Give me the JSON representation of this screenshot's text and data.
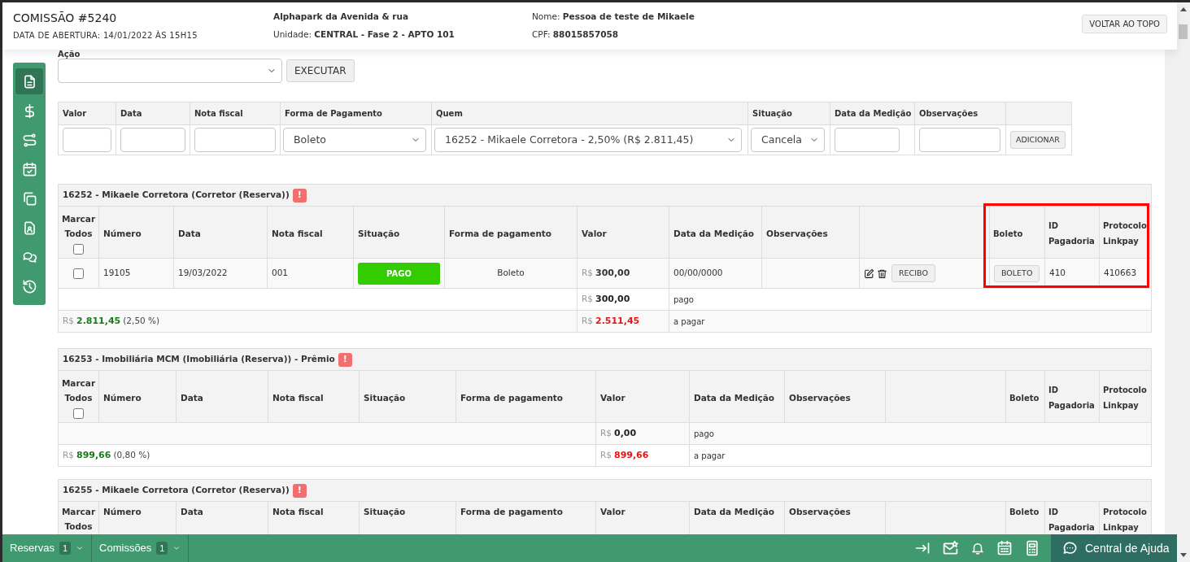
{
  "header": {
    "title": "COMISSÃO #5240",
    "opened": "DATA DE ABERTURA: 14/01/2022 ÀS 15H15",
    "development": "Alphapark da Avenida & rua",
    "unit": "Unidade: **CENTRAL - Fase 2 - APTO 101**",
    "client": "Nome: **Pessoa de teste de Mikaele**",
    "cpf": "CPF: **88015857058**",
    "back_to_top": "VOLTAR AO TOPO"
  },
  "sidebar": {
    "items": [
      {
        "selected": true
      },
      {
        "selected": false
      },
      {
        "selected": false
      },
      {
        "selected": false
      },
      {
        "selected": false
      },
      {
        "selected": false
      },
      {
        "selected": false
      },
      {
        "selected": false
      }
    ]
  },
  "action": {
    "label": "Ação",
    "button": "EXECUTAR"
  },
  "entry_form": {
    "columns": [
      "Valor",
      "Data",
      "Nota fiscal",
      "Forma de Pagamento",
      "Quem",
      "Situação",
      "Data da Medição",
      "Observações"
    ],
    "payment_method": "Boleto",
    "who": "16252 - Mikaele Corretora - 2,50% (R$ 2.811,45)",
    "status": "Cancela",
    "button": "ADICIONAR"
  },
  "sections": [
    {
      "title": "16252 - Mikaele Corretora (Corretor (Reserva))",
      "alert": "!",
      "select_all_checked": false,
      "highlight_payment_columns": true,
      "columns": [
        "Marcar Todos",
        "Número",
        "Data",
        "Nota fiscal",
        "Situação",
        "Forma de pagamento",
        "Valor",
        "Data da Medição",
        "Observações"
      ],
      "payment_columns": [
        "Boleto",
        "ID Pagadoria",
        "Protocolo Linkpay"
      ],
      "rows": [
        {
          "checked": false,
          "number": "19105",
          "date": "19/03/2022",
          "invoice": "001",
          "status": "PAGO",
          "payment_method": "Boleto",
          "currency": "R$",
          "value": "300,00",
          "measurement_date": "00/00/0000",
          "receipt": "RECIBO",
          "boleto": "BOLETO",
          "payment_id": "410",
          "protocol": "410663"
        }
      ],
      "paid": {
        "currency": "R$",
        "amount": "300,00",
        "label": "pago"
      },
      "due": {
        "total_currency": "R$",
        "total": "2.811,45",
        "percent": "(2,50 %)",
        "currency": "R$",
        "amount": "2.511,45",
        "label": "a pagar"
      }
    },
    {
      "title": "16253 - Imobiliária MCM (Imobiliária (Reserva)) - Prêmio",
      "alert": "!",
      "select_all_checked": false,
      "highlight_payment_columns": false,
      "columns": [
        "Marcar Todos",
        "Número",
        "Data",
        "Nota fiscal",
        "Situação",
        "Forma de pagamento",
        "Valor",
        "Data da Medição",
        "Observações"
      ],
      "payment_columns": [
        "Boleto",
        "ID Pagadoria",
        "Protocolo Linkpay"
      ],
      "paid": {
        "currency": "R$",
        "amount": "0,00",
        "label": "pago"
      },
      "due": {
        "total_currency": "R$",
        "total": "899,66",
        "percent": "(0,80 %)",
        "currency": "R$",
        "amount": "899,66",
        "label": "a pagar"
      }
    },
    {
      "title": "16255 - Mikaele Corretora (Corretor (Reserva))",
      "alert": "!",
      "highlight_payment_columns": false,
      "columns": [
        "Marcar Todos",
        "Número",
        "Data",
        "Nota fiscal",
        "Situação",
        "Forma de pagamento",
        "Valor",
        "Data da Medição",
        "Observações"
      ],
      "payment_columns": [
        "Boleto",
        "ID Pagadoria",
        "Protocolo Linkpay"
      ]
    }
  ],
  "bottom_bar": {
    "tabs": [
      {
        "label": "Reservas",
        "count": "1"
      },
      {
        "label": "Comissões",
        "count": "1"
      }
    ],
    "help": "Central de Ajuda"
  }
}
